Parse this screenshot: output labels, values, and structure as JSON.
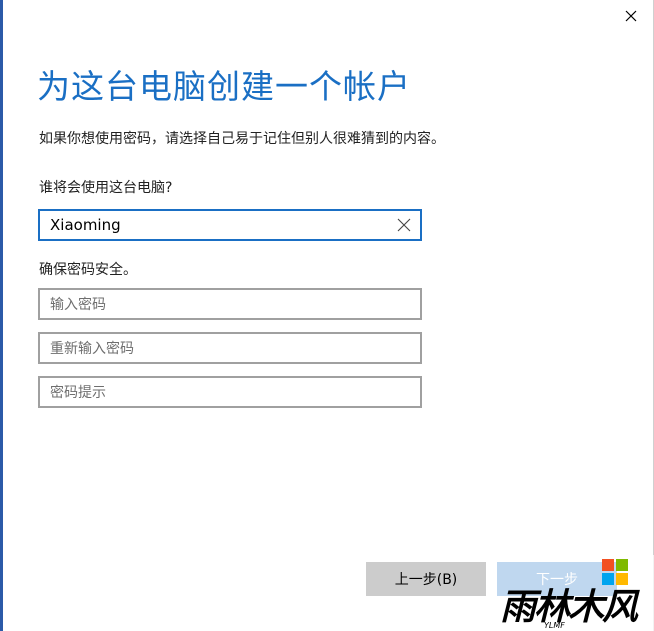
{
  "dialog": {
    "title": "为这台电脑创建一个帐户",
    "description": "如果你想使用密码，请选择自己易于记住但别人很难猜到的内容。",
    "who_label": "谁将会使用这台电脑?",
    "username_value": "Xiaoming",
    "secure_label": "确保密码安全。",
    "password_placeholder": "输入密码",
    "reenter_placeholder": "重新输入密码",
    "hint_placeholder": "密码提示"
  },
  "buttons": {
    "back_label": "上一步(B)",
    "next_label": "下一步"
  },
  "watermark": {
    "text": "雨林木风",
    "subtext": "YLMF"
  },
  "colors": {
    "accent": "#1a6fc4",
    "button_gray": "#cccccc",
    "field_border": "#a0a0a0"
  }
}
